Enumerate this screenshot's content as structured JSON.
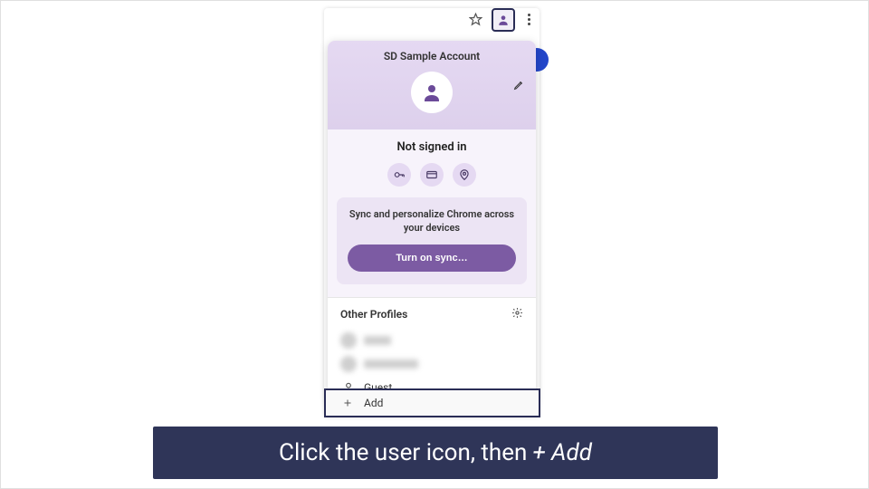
{
  "toolbar": {
    "star_name": "bookmark-star-icon",
    "profile_name": "profile-icon",
    "kebab_name": "more-icon"
  },
  "popup": {
    "account_name": "SD Sample Account",
    "edit_name": "edit-icon",
    "signin_status": "Not signed in",
    "chips": [
      "key-icon",
      "credit-card-icon",
      "location-pin-icon"
    ],
    "sync_text": "Sync and personalize Chrome across your devices",
    "sync_button": "Turn on sync…",
    "other_title": "Other Profiles",
    "gear_name": "settings-gear-icon",
    "guest_label": "Guest",
    "add_label": "Add"
  },
  "caption": {
    "prefix": "Click the user icon, then ",
    "action": "+ Add"
  },
  "colors": {
    "accent": "#7c5ba3",
    "highlight_border": "#2a2d56",
    "caption_bg": "#2f3558"
  }
}
